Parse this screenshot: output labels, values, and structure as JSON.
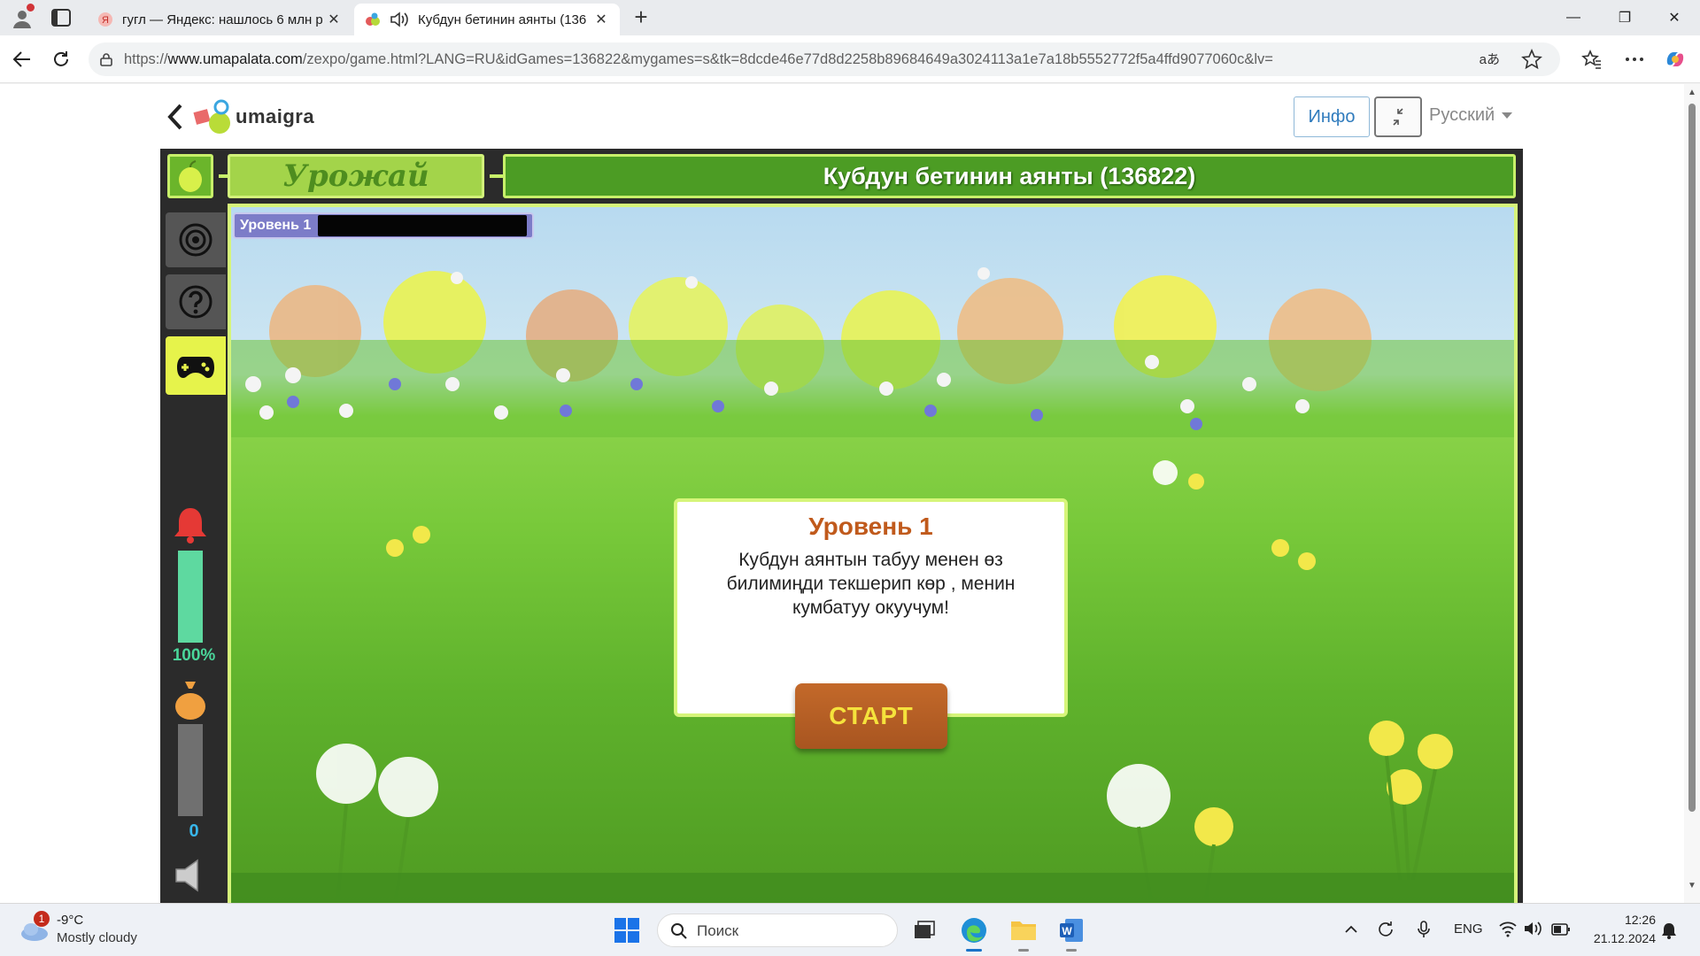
{
  "browser": {
    "tabs": [
      {
        "label": "гугл — Яндекс: нашлось 6 млн р",
        "active": false
      },
      {
        "label": "Кубдун бетинин аянты (136",
        "active": true
      }
    ],
    "url_prefix": "https://",
    "url_host": "www.umapalata.com",
    "url_path": "/zexpo/game.html?LANG=RU&idGames=136822&mygames=s&tk=8dcde46e77d8d2258b89684649a3024113a1e7a18b5552772f5a4ffd9077060c&lv=",
    "reader_label": "aあ"
  },
  "site": {
    "logo_text": "umaigra",
    "info_label": "Инфо",
    "language": "Русский"
  },
  "game": {
    "category_title": "Урожай",
    "game_title": "Кубдун бетинин аянты (136822)",
    "level_label": "Уровень 1",
    "life_percent": 100,
    "life_text": "100%",
    "score_text": "0",
    "dialog": {
      "title": "Уровень 1",
      "body": "Кубдун аянтын табуу менен өз билимиңди текшерип көр , менин кумбатуу окуучум!",
      "start_label": "СТАРТ"
    }
  },
  "taskbar": {
    "weather_badge": "1",
    "temperature": "-9°C",
    "condition": "Mostly cloudy",
    "search_placeholder": "Поиск",
    "lang": "ENG",
    "time": "12:26",
    "date": "21.12.2024"
  },
  "colors": {
    "accent_green": "#4c9c24",
    "frame_lime": "#d6f57a",
    "start_orange": "#b85e24",
    "dialog_title": "#c05a1c"
  }
}
